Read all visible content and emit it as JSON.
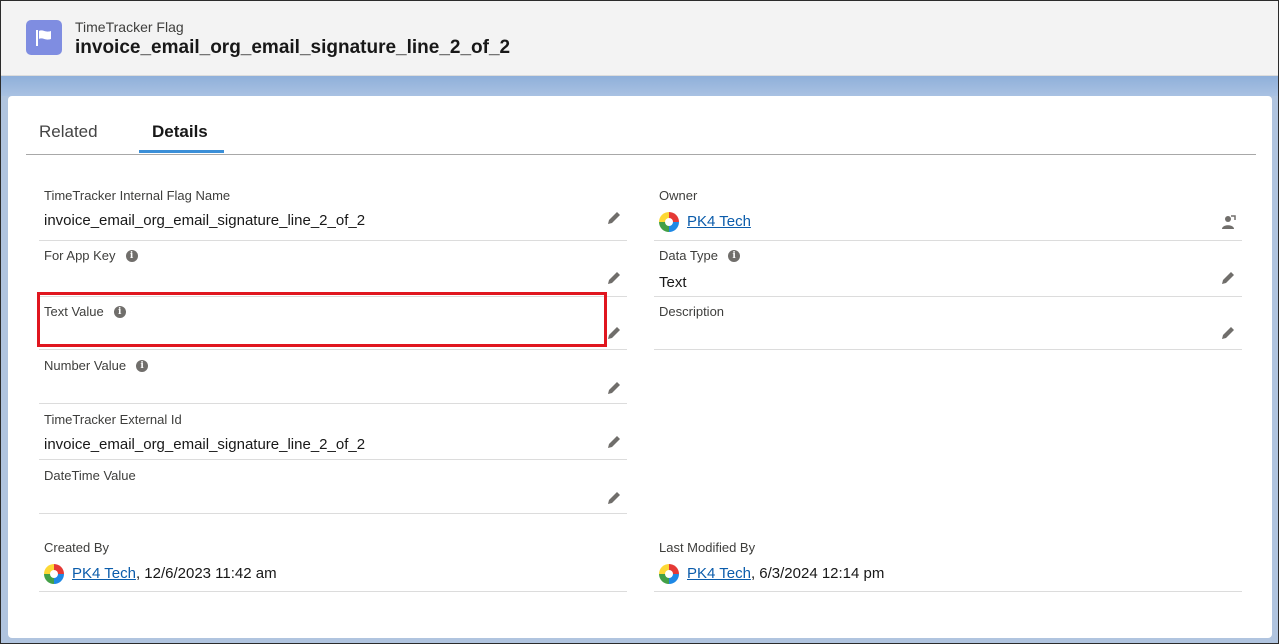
{
  "header": {
    "object_label": "TimeTracker Flag",
    "record_title": "invoice_email_org_email_signature_line_2_of_2",
    "icon": "flag-icon"
  },
  "tabs": [
    {
      "label": "Related",
      "active": false
    },
    {
      "label": "Details",
      "active": true
    }
  ],
  "fields": {
    "internal_flag_name": {
      "label": "TimeTracker Internal Flag Name",
      "value": "invoice_email_org_email_signature_line_2_of_2"
    },
    "for_app_key": {
      "label": "For App Key",
      "value": ""
    },
    "text_value": {
      "label": "Text Value",
      "value": ""
    },
    "number_value": {
      "label": "Number Value",
      "value": ""
    },
    "external_id": {
      "label": "TimeTracker External Id",
      "value": "invoice_email_org_email_signature_line_2_of_2"
    },
    "datetime_value": {
      "label": "DateTime Value",
      "value": ""
    },
    "owner": {
      "label": "Owner",
      "value": "PK4 Tech"
    },
    "data_type": {
      "label": "Data Type",
      "value": "Text"
    },
    "description": {
      "label": "Description",
      "value": ""
    },
    "created_by": {
      "label": "Created By",
      "user": "PK4 Tech",
      "date": ", 12/6/2023 11:42 am"
    },
    "last_modified_by": {
      "label": "Last Modified By",
      "user": "PK4 Tech",
      "date": ", 6/3/2024 12:14 pm"
    }
  },
  "colors": {
    "accent": "#3b8fd8",
    "highlight": "#e0161f",
    "object_icon": "#7f8de1",
    "link": "#0b5cab"
  }
}
